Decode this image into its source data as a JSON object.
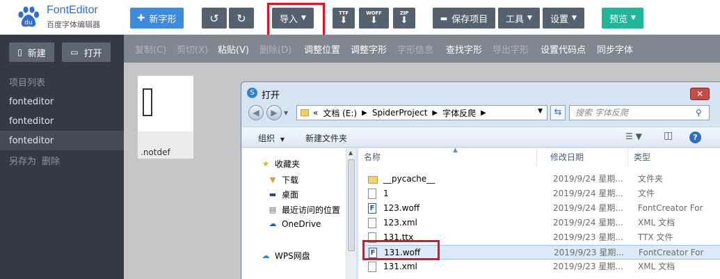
{
  "app": {
    "logo_title": "FontEditor",
    "logo_sub": "百度字体编辑器"
  },
  "toolbar": {
    "new_glyph": "新字形",
    "import": "导入",
    "ttf": "TTF",
    "woff": "WOFF",
    "zip": "ZIP",
    "save_project": "保存项目",
    "tools": "工具",
    "settings": "设置",
    "preview": "预览"
  },
  "sidebar": {
    "new_label": "新建",
    "open_label": "打开",
    "project_list_label": "项目列表",
    "projects": [
      "fonteditor",
      "fonteditor",
      "fonteditor"
    ],
    "save_as": "另存为",
    "delete": "删除"
  },
  "actions": {
    "copy": "复制(C)",
    "cut": "剪切(X)",
    "paste": "粘贴(V)",
    "delete": "删除(D)",
    "adjust_pos": "调整位置",
    "adjust_glyph": "调整字形",
    "glyph_info": "字形信息",
    "find_glyph": "查找字形",
    "export_glyph": "导出字形",
    "set_codepoint": "设置代码点",
    "sync_font": "同步字体"
  },
  "glyph": {
    "name": ".notdef"
  },
  "dialog": {
    "title": "打开",
    "address": {
      "prefix": "«",
      "segments": [
        "文档 (E:)",
        "SpiderProject",
        "字体反爬"
      ]
    },
    "search_placeholder": "搜索 字体反爬",
    "organize": "组织",
    "new_folder": "新建文件夹",
    "nav": {
      "favorites": "收藏夹",
      "downloads": "下载",
      "desktop": "桌面",
      "recent": "最近访问的位置",
      "onedrive": "OneDrive",
      "wps": "WPS网盘"
    },
    "columns": {
      "name": "名称",
      "date": "修改日期",
      "type": "类型"
    },
    "files": [
      {
        "name": "__pycache__",
        "date": "2019/9/24 星期...",
        "type": "文件夹",
        "icon": "folder"
      },
      {
        "name": "1",
        "date": "2019/9/24 星期...",
        "type": "文件",
        "icon": "doc"
      },
      {
        "name": "123.woff",
        "date": "2019/9/24 星期...",
        "type": "FontCreator For",
        "icon": "fc"
      },
      {
        "name": "123.xml",
        "date": "2019/9/24 星期...",
        "type": "XML 文档",
        "icon": "xml"
      },
      {
        "name": "131.ttx",
        "date": "2019/9/23 星期...",
        "type": "TTX 文件",
        "icon": "doc"
      },
      {
        "name": "131.woff",
        "date": "2019/9/23 星期...",
        "type": "FontCreator For",
        "icon": "fc"
      },
      {
        "name": "131.xml",
        "date": "2019/9/23 星期...",
        "type": "XML 文档",
        "icon": "xml"
      }
    ]
  }
}
